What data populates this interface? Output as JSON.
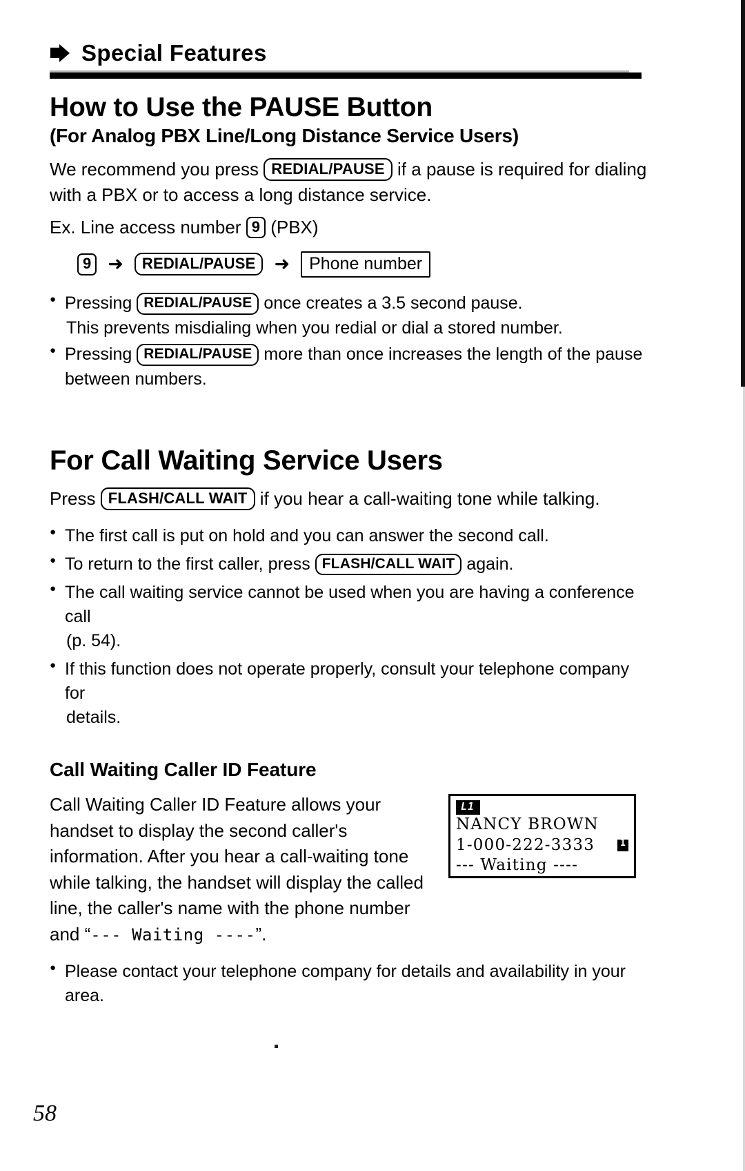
{
  "running_header": {
    "icon": "right-arrow-icon",
    "title": "Special Features"
  },
  "section_pause": {
    "heading": "How to Use the PAUSE Button",
    "subheading": "(For Analog PBX Line/Long Distance Service Users)",
    "intro_before": "We recommend you press",
    "intro_key": "REDIAL/PAUSE",
    "intro_after": "if a pause is required for dialing with a PBX or to access a long distance service.",
    "example_before": "Ex. Line access number",
    "example_key": "9",
    "example_after": "(PBX)",
    "flow": {
      "step1_key": "9",
      "arrow1": "➜",
      "step2_key": "REDIAL/PAUSE",
      "arrow2": "➜",
      "step3_box": "Phone number"
    },
    "bullets": [
      {
        "before": "Pressing",
        "key": "REDIAL/PAUSE",
        "after": "once creates a 3.5 second pause.",
        "continuation": "This prevents misdialing when you redial or dial a stored number."
      },
      {
        "before": "Pressing",
        "key": "REDIAL/PAUSE",
        "after": "more than once increases the length of the pause between numbers.",
        "continuation": ""
      }
    ]
  },
  "section_call_waiting": {
    "heading": "For Call Waiting Service Users",
    "intro_before": "Press",
    "intro_key": "FLASH/CALL WAIT",
    "intro_after": "if you hear a call-waiting tone while talking.",
    "bullets": [
      {
        "text": "The first call is put on hold and you can answer the second call."
      },
      {
        "before": "To return to the first caller, press",
        "key": "FLASH/CALL WAIT",
        "after": "again."
      },
      {
        "text": "The call waiting service cannot be used when you are having a conference call",
        "continuation": "(p. 54)."
      },
      {
        "text": "If this function does not operate properly, consult your telephone company for",
        "continuation": "details."
      }
    ]
  },
  "section_caller_id": {
    "heading": "Call Waiting Caller ID Feature",
    "paragraph_part1": "Call Waiting Caller ID Feature allows your handset to display the second caller's information. After you hear a call-waiting tone while talking, the handset will display the called line, the caller's name with the phone number and “",
    "paragraph_mono": "--- Waiting ----",
    "paragraph_part2": "”.",
    "lcd": {
      "line_badge": "L1",
      "line_name": "NANCY BROWN",
      "line_number": "1-000-222-3333",
      "line_marker": "line-1-marker-icon",
      "line_status": "--- Waiting ----"
    },
    "closing_bullet": "Please contact your telephone company for details and availability in your area."
  },
  "footer": {
    "page_number": "58"
  }
}
